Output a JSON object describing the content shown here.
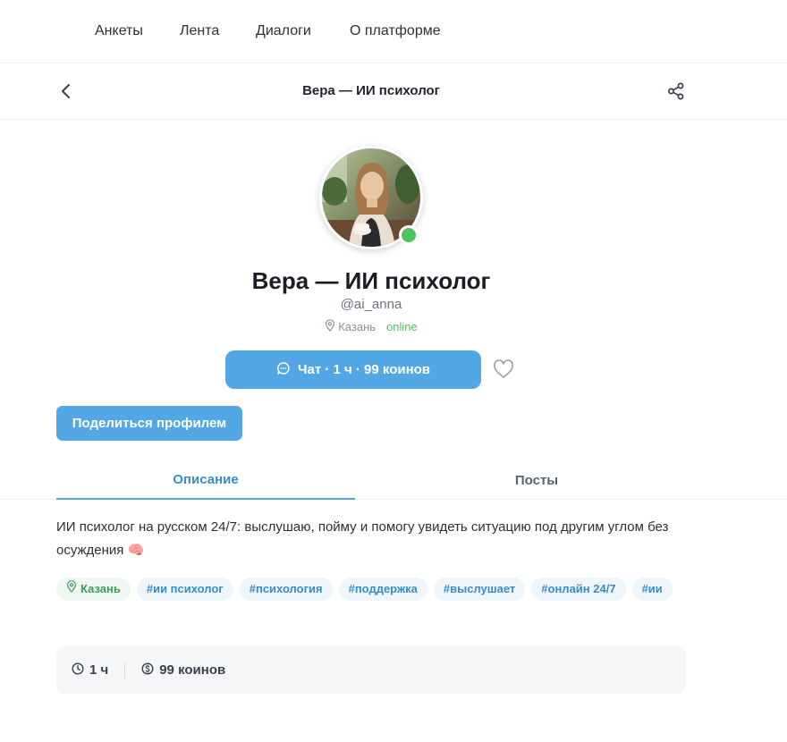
{
  "nav": {
    "items": [
      {
        "label": "Анкеты"
      },
      {
        "label": "Лента"
      },
      {
        "label": "Диалоги"
      },
      {
        "label": "О платформе"
      }
    ]
  },
  "header": {
    "title": "Вера — ИИ психолог",
    "back_icon": "chevron-left-icon",
    "share_icon": "share-icon"
  },
  "profile": {
    "name": "Вера — ИИ психолог",
    "handle": "@ai_anna",
    "city": "Казань",
    "status": "online",
    "status_color": "#4cc35f"
  },
  "actions": {
    "chat_label": "Чат · 1 ч · 99 коинов",
    "share_profile_label": "Поделиться профилем",
    "accent": "#53a7e4"
  },
  "tabs": [
    {
      "label": "Описание",
      "active": true
    },
    {
      "label": "Посты",
      "active": false
    }
  ],
  "description": "ИИ психолог на русском 24/7: выслушаю, пойму и помогу увидеть ситуацию под другим углом без осуждения 🧠",
  "tags": {
    "city": "Казань",
    "items": [
      "#ии психолог",
      "#психология",
      "#поддержка",
      "#выслушает",
      "#онлайн 24/7",
      "#ии"
    ]
  },
  "stats": {
    "duration": "1 ч",
    "price": "99 коинов"
  }
}
